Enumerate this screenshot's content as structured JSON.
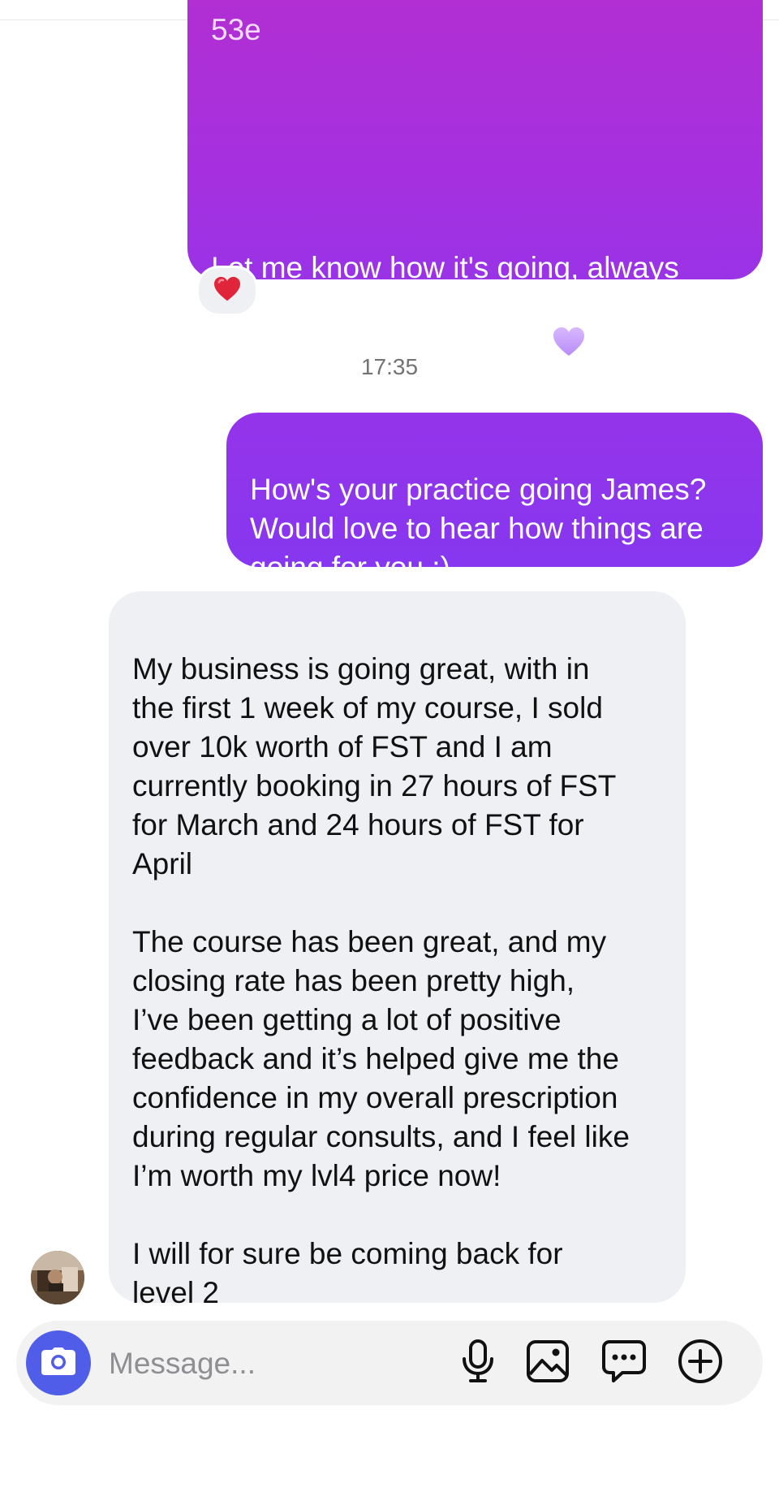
{
  "header": {
    "cut_off_title": "(…)"
  },
  "messages": {
    "first_outgoing": {
      "cut_off_top_line": "53e",
      "text": "Let me know how it's going, always\nhere if you need anything",
      "emoji": "purple-heart-emoji",
      "reaction": {
        "emoji": "red-heart-emoji"
      }
    },
    "timestamp": "17:35",
    "second_outgoing": {
      "text": "How's your practice going James?\nWould love to hear how things are\ngoing for you :)"
    },
    "incoming": {
      "text": "My business is going great, with in\nthe first 1 week of my course, I sold\nover 10k worth of FST and I am\ncurrently booking in 27 hours of FST\nfor March and 24 hours of FST for\nApril\n\nThe course has been great, and my\nclosing rate has been pretty high,\nI’ve been getting a lot of positive\nfeedback and it’s helped give me the\nconfidence in my overall prescription\nduring regular consults, and I feel like\nI’m worth my lvl4 price now!\n\nI will for sure be coming back for\nlevel 2",
      "sender_avatar": "sender-avatar"
    }
  },
  "composer": {
    "placeholder": "Message...",
    "value": "",
    "icons": {
      "camera": "camera-icon",
      "microphone": "microphone-icon",
      "gallery": "image-gallery-icon",
      "sticker": "sticker-chat-icon",
      "more": "plus-circle-icon"
    }
  },
  "colors": {
    "outgoing_bubble_top": "#b12fd3",
    "outgoing_bubble_bottom": "#8637ef",
    "incoming_bubble": "#eef0f3",
    "camera_button": "#4f5de8",
    "timestamp_text": "#737373"
  }
}
